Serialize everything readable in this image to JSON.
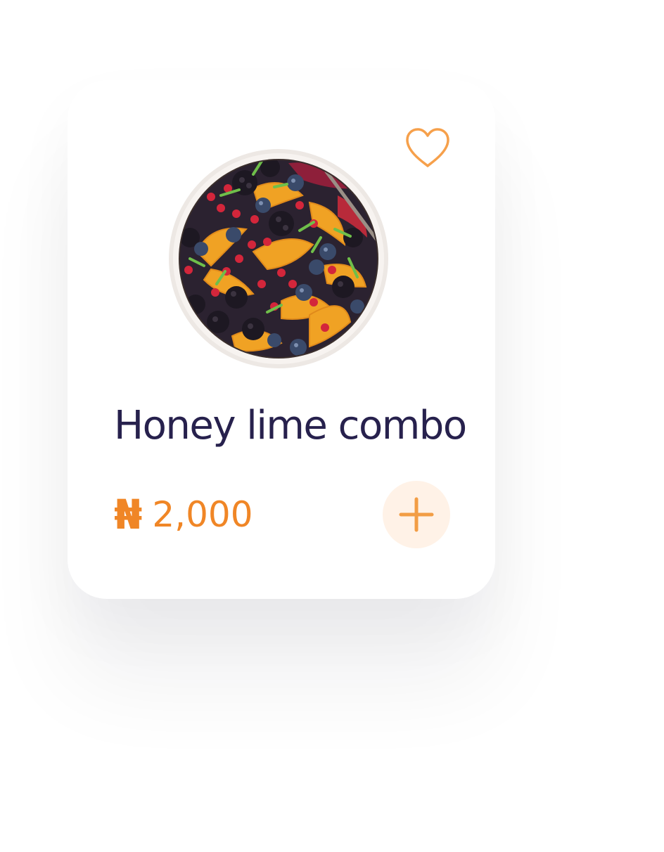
{
  "product": {
    "title": "Honey lime combo",
    "currency_symbol": "₦",
    "price": "2,000",
    "image_icon": "fruit-salad-bowl",
    "favorite_icon": "heart-outline-icon",
    "add_icon": "plus-icon",
    "is_favorite": false
  },
  "colors": {
    "title": "#27214d",
    "accent": "#f08626",
    "add_button_bg": "#fff2e7",
    "card_bg": "#ffffff"
  }
}
